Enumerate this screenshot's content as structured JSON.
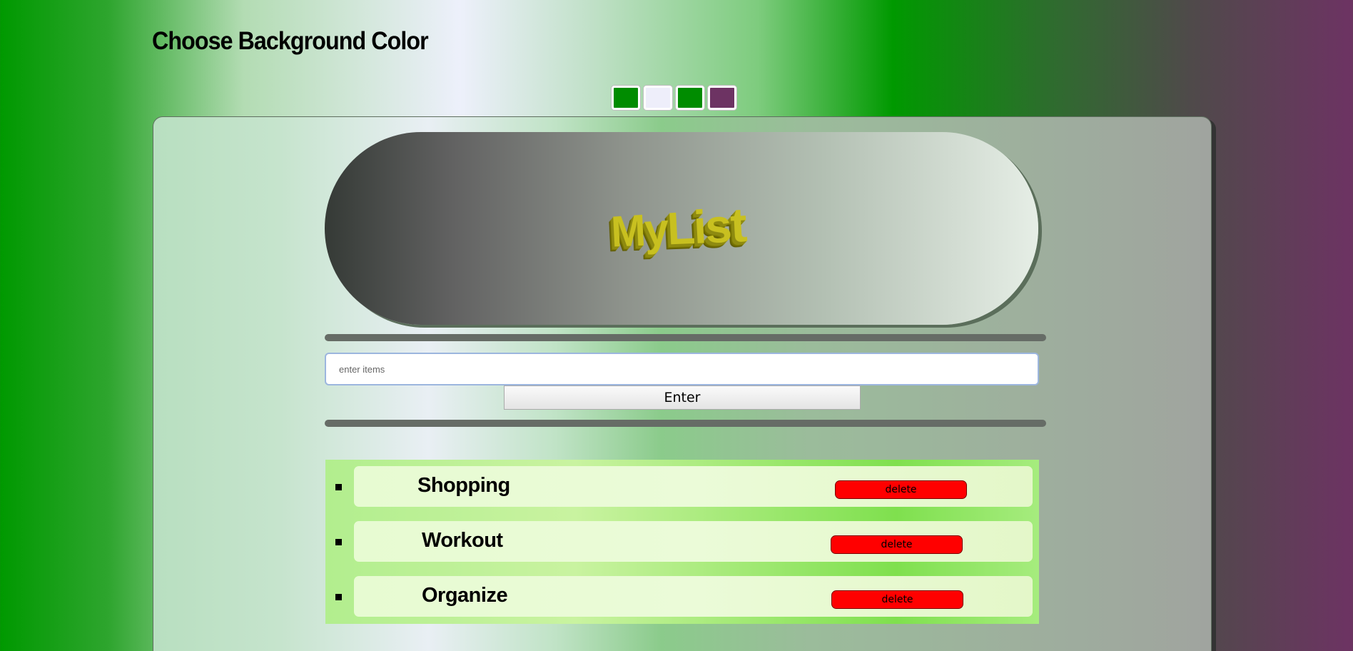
{
  "header": {
    "title": "Choose Background Color"
  },
  "swatches": [
    {
      "name": "green",
      "color": "#008c00"
    },
    {
      "name": "lavender",
      "color": "#eeeefa"
    },
    {
      "name": "green-2",
      "color": "#008c00"
    },
    {
      "name": "purple",
      "color": "#6d3363"
    }
  ],
  "banner": {
    "title": "MyList"
  },
  "form": {
    "input_placeholder": "enter items",
    "input_value": "",
    "enter_label": "Enter"
  },
  "list": {
    "items": [
      {
        "label": "Shopping",
        "delete_label": "delete"
      },
      {
        "label": "Workout",
        "delete_label": "delete"
      },
      {
        "label": "Organize",
        "delete_label": "delete"
      }
    ]
  }
}
